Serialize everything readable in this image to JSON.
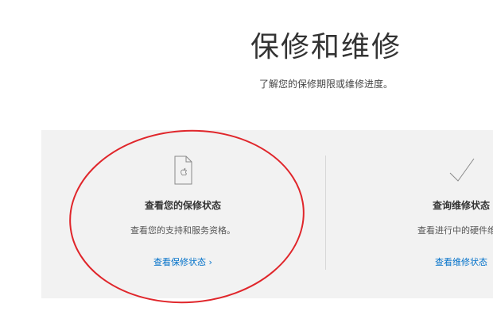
{
  "header": {
    "title": "保修和维修",
    "subtitle": "了解您的保修期限或维修进度。"
  },
  "cards": [
    {
      "icon": "document-apple-icon",
      "title": "查看您的保修状态",
      "description": "查看您的支持和服务资格。",
      "link_label": "查看保修状态",
      "link_chevron": "›"
    },
    {
      "icon": "checkmark-icon",
      "title": "查询维修状态",
      "description": "查看进行中的硬件维修",
      "link_label": "查看维修状态"
    }
  ],
  "colors": {
    "panel_bg": "#f2f2f2",
    "link": "#0070c9",
    "annotation": "#e0262b"
  }
}
